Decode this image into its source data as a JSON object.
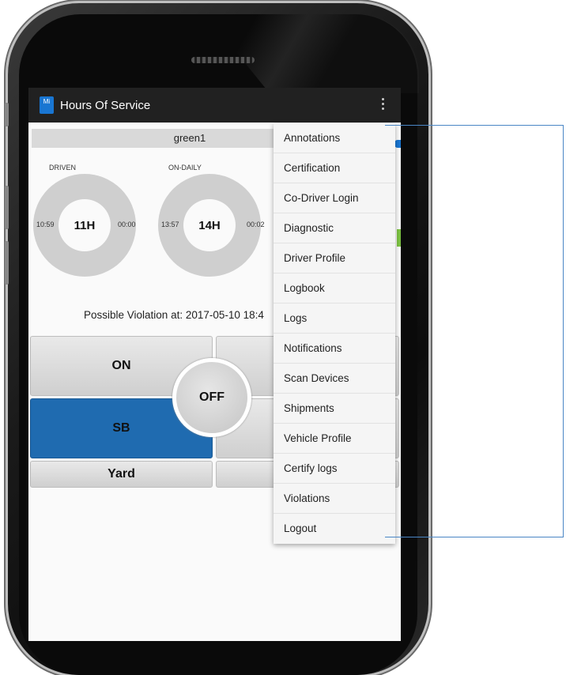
{
  "app": {
    "title": "Hours Of Service",
    "logo_text": "Mi"
  },
  "driver": {
    "name": "green1"
  },
  "gauges": [
    {
      "label": "DRIVEN",
      "center": "11H",
      "left_time": "10:59",
      "right_time": "00:00"
    },
    {
      "label": "ON-DAILY",
      "center": "14H",
      "left_time": "13:57",
      "right_time": "00:02"
    }
  ],
  "violation": {
    "text": "Possible Violation at: 2017-05-10 18:4"
  },
  "status_buttons": {
    "on": "ON",
    "off": "OFF",
    "sb": "SB",
    "yard": "Yard"
  },
  "menu": {
    "items": [
      "Annotations",
      "Certification",
      "Co-Driver Login",
      "Diagnostic",
      "Driver Profile",
      "Logbook",
      "Logs",
      "Notifications",
      "Scan Devices",
      "Shipments",
      "Vehicle Profile",
      "Certify logs",
      "Violations",
      "Logout"
    ]
  },
  "colors": {
    "appbar": "#212121",
    "active_status": "#1f6bb0",
    "callout_line": "#4a86c5",
    "gauge_ring": "#cfcfcf"
  }
}
